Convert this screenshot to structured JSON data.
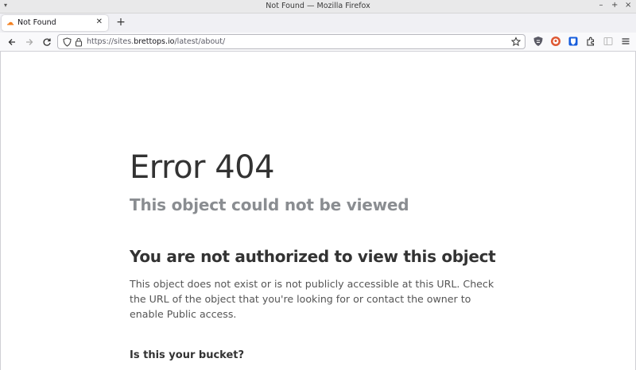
{
  "window": {
    "title": "Not Found — Mozilla Firefox",
    "controls": {
      "minimize": "–",
      "maximize": "+",
      "close": "×"
    }
  },
  "tabs": [
    {
      "label": "Not Found",
      "favicon": "cloudflare-icon",
      "active": true
    }
  ],
  "new_tab_label": "+",
  "navbar": {
    "url_prefix": "https://sites.",
    "url_host": "brettops.io",
    "url_path": "/latest/about/",
    "icons": [
      "back-icon",
      "forward-icon",
      "reload-icon",
      "shield-icon",
      "lock-icon",
      "star-icon",
      "ublock-icon",
      "duckduckgo-icon",
      "bitwarden-icon",
      "extensions-icon",
      "sidebar-icon",
      "menu-icon"
    ]
  },
  "page": {
    "title": "Error 404",
    "subtitle": "This object could not be viewed",
    "heading": "You are not authorized to view this object",
    "body": "This object does not exist or is not publicly accessible at this URL. Check the URL of the object that you're looking for or contact the owner to enable Public access.",
    "bucket_question": "Is this your bucket?"
  },
  "colors": {
    "accent": "#f38020",
    "title_text": "#333333",
    "subtitle_text": "#8a8d91"
  }
}
